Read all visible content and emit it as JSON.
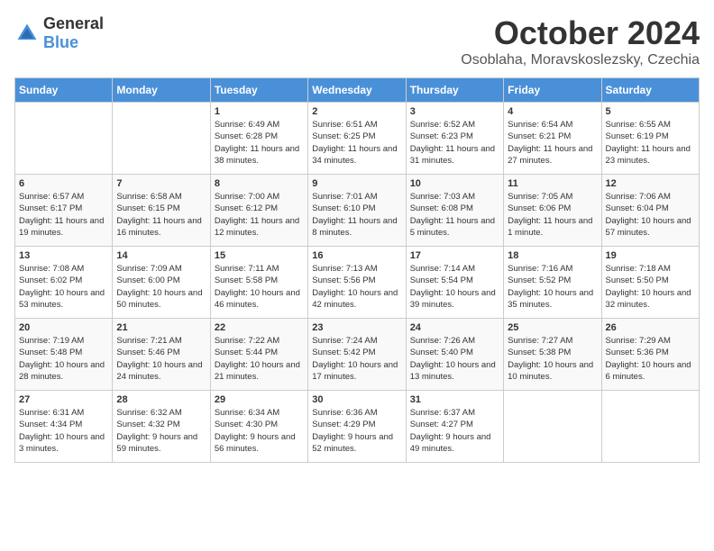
{
  "header": {
    "logo_general": "General",
    "logo_blue": "Blue",
    "month": "October 2024",
    "location": "Osoblaha, Moravskoslezsky, Czechia"
  },
  "weekdays": [
    "Sunday",
    "Monday",
    "Tuesday",
    "Wednesday",
    "Thursday",
    "Friday",
    "Saturday"
  ],
  "weeks": [
    [
      {
        "day": "",
        "info": ""
      },
      {
        "day": "",
        "info": ""
      },
      {
        "day": "1",
        "info": "Sunrise: 6:49 AM\nSunset: 6:28 PM\nDaylight: 11 hours and 38 minutes."
      },
      {
        "day": "2",
        "info": "Sunrise: 6:51 AM\nSunset: 6:25 PM\nDaylight: 11 hours and 34 minutes."
      },
      {
        "day": "3",
        "info": "Sunrise: 6:52 AM\nSunset: 6:23 PM\nDaylight: 11 hours and 31 minutes."
      },
      {
        "day": "4",
        "info": "Sunrise: 6:54 AM\nSunset: 6:21 PM\nDaylight: 11 hours and 27 minutes."
      },
      {
        "day": "5",
        "info": "Sunrise: 6:55 AM\nSunset: 6:19 PM\nDaylight: 11 hours and 23 minutes."
      }
    ],
    [
      {
        "day": "6",
        "info": "Sunrise: 6:57 AM\nSunset: 6:17 PM\nDaylight: 11 hours and 19 minutes."
      },
      {
        "day": "7",
        "info": "Sunrise: 6:58 AM\nSunset: 6:15 PM\nDaylight: 11 hours and 16 minutes."
      },
      {
        "day": "8",
        "info": "Sunrise: 7:00 AM\nSunset: 6:12 PM\nDaylight: 11 hours and 12 minutes."
      },
      {
        "day": "9",
        "info": "Sunrise: 7:01 AM\nSunset: 6:10 PM\nDaylight: 11 hours and 8 minutes."
      },
      {
        "day": "10",
        "info": "Sunrise: 7:03 AM\nSunset: 6:08 PM\nDaylight: 11 hours and 5 minutes."
      },
      {
        "day": "11",
        "info": "Sunrise: 7:05 AM\nSunset: 6:06 PM\nDaylight: 11 hours and 1 minute."
      },
      {
        "day": "12",
        "info": "Sunrise: 7:06 AM\nSunset: 6:04 PM\nDaylight: 10 hours and 57 minutes."
      }
    ],
    [
      {
        "day": "13",
        "info": "Sunrise: 7:08 AM\nSunset: 6:02 PM\nDaylight: 10 hours and 53 minutes."
      },
      {
        "day": "14",
        "info": "Sunrise: 7:09 AM\nSunset: 6:00 PM\nDaylight: 10 hours and 50 minutes."
      },
      {
        "day": "15",
        "info": "Sunrise: 7:11 AM\nSunset: 5:58 PM\nDaylight: 10 hours and 46 minutes."
      },
      {
        "day": "16",
        "info": "Sunrise: 7:13 AM\nSunset: 5:56 PM\nDaylight: 10 hours and 42 minutes."
      },
      {
        "day": "17",
        "info": "Sunrise: 7:14 AM\nSunset: 5:54 PM\nDaylight: 10 hours and 39 minutes."
      },
      {
        "day": "18",
        "info": "Sunrise: 7:16 AM\nSunset: 5:52 PM\nDaylight: 10 hours and 35 minutes."
      },
      {
        "day": "19",
        "info": "Sunrise: 7:18 AM\nSunset: 5:50 PM\nDaylight: 10 hours and 32 minutes."
      }
    ],
    [
      {
        "day": "20",
        "info": "Sunrise: 7:19 AM\nSunset: 5:48 PM\nDaylight: 10 hours and 28 minutes."
      },
      {
        "day": "21",
        "info": "Sunrise: 7:21 AM\nSunset: 5:46 PM\nDaylight: 10 hours and 24 minutes."
      },
      {
        "day": "22",
        "info": "Sunrise: 7:22 AM\nSunset: 5:44 PM\nDaylight: 10 hours and 21 minutes."
      },
      {
        "day": "23",
        "info": "Sunrise: 7:24 AM\nSunset: 5:42 PM\nDaylight: 10 hours and 17 minutes."
      },
      {
        "day": "24",
        "info": "Sunrise: 7:26 AM\nSunset: 5:40 PM\nDaylight: 10 hours and 13 minutes."
      },
      {
        "day": "25",
        "info": "Sunrise: 7:27 AM\nSunset: 5:38 PM\nDaylight: 10 hours and 10 minutes."
      },
      {
        "day": "26",
        "info": "Sunrise: 7:29 AM\nSunset: 5:36 PM\nDaylight: 10 hours and 6 minutes."
      }
    ],
    [
      {
        "day": "27",
        "info": "Sunrise: 6:31 AM\nSunset: 4:34 PM\nDaylight: 10 hours and 3 minutes."
      },
      {
        "day": "28",
        "info": "Sunrise: 6:32 AM\nSunset: 4:32 PM\nDaylight: 9 hours and 59 minutes."
      },
      {
        "day": "29",
        "info": "Sunrise: 6:34 AM\nSunset: 4:30 PM\nDaylight: 9 hours and 56 minutes."
      },
      {
        "day": "30",
        "info": "Sunrise: 6:36 AM\nSunset: 4:29 PM\nDaylight: 9 hours and 52 minutes."
      },
      {
        "day": "31",
        "info": "Sunrise: 6:37 AM\nSunset: 4:27 PM\nDaylight: 9 hours and 49 minutes."
      },
      {
        "day": "",
        "info": ""
      },
      {
        "day": "",
        "info": ""
      }
    ]
  ]
}
